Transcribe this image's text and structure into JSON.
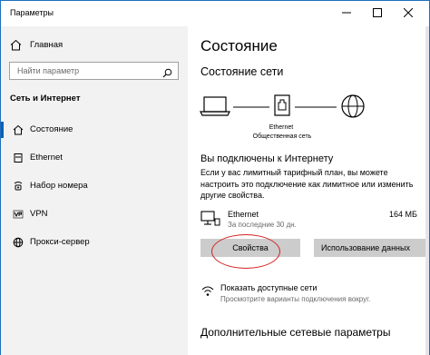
{
  "window": {
    "title": "Параметры"
  },
  "sidebar": {
    "home": "Главная",
    "search_placeholder": "Найти параметр",
    "section_title": "Сеть и Интернет",
    "items": [
      {
        "label": "Состояние",
        "icon": "home-status-icon",
        "active": true
      },
      {
        "label": "Ethernet",
        "icon": "ethernet-icon",
        "active": false
      },
      {
        "label": "Набор номера",
        "icon": "dialup-icon",
        "active": false
      },
      {
        "label": "VPN",
        "icon": "vpn-icon",
        "active": false
      },
      {
        "label": "Прокси-сервер",
        "icon": "globe-icon",
        "active": false
      }
    ]
  },
  "main": {
    "title": "Состояние",
    "network_status_title": "Состояние сети",
    "diagram": {
      "middle_label_1": "Ethernet",
      "middle_label_2": "Общественная сеть"
    },
    "connected_title": "Вы подключены к Интернету",
    "description": "Если у вас лимитный тарифный план, вы можете настроить это подключение как лимитное или изменить другие свойства.",
    "connection": {
      "name": "Ethernet",
      "period": "За последние 30 дн.",
      "size": "164 МБ"
    },
    "buttons": {
      "properties": "Свойства",
      "usage": "Использование данных"
    },
    "available": {
      "title": "Показать доступные сети",
      "subtitle": "Просмотрите варианты подключения вокруг."
    },
    "extra_title": "Дополнительные сетевые параметры"
  },
  "colors": {
    "accent": "#0063b1",
    "sidebar_bg": "#f2f2f2",
    "button_bg": "#cccccc",
    "highlight_circle": "#d42020"
  }
}
